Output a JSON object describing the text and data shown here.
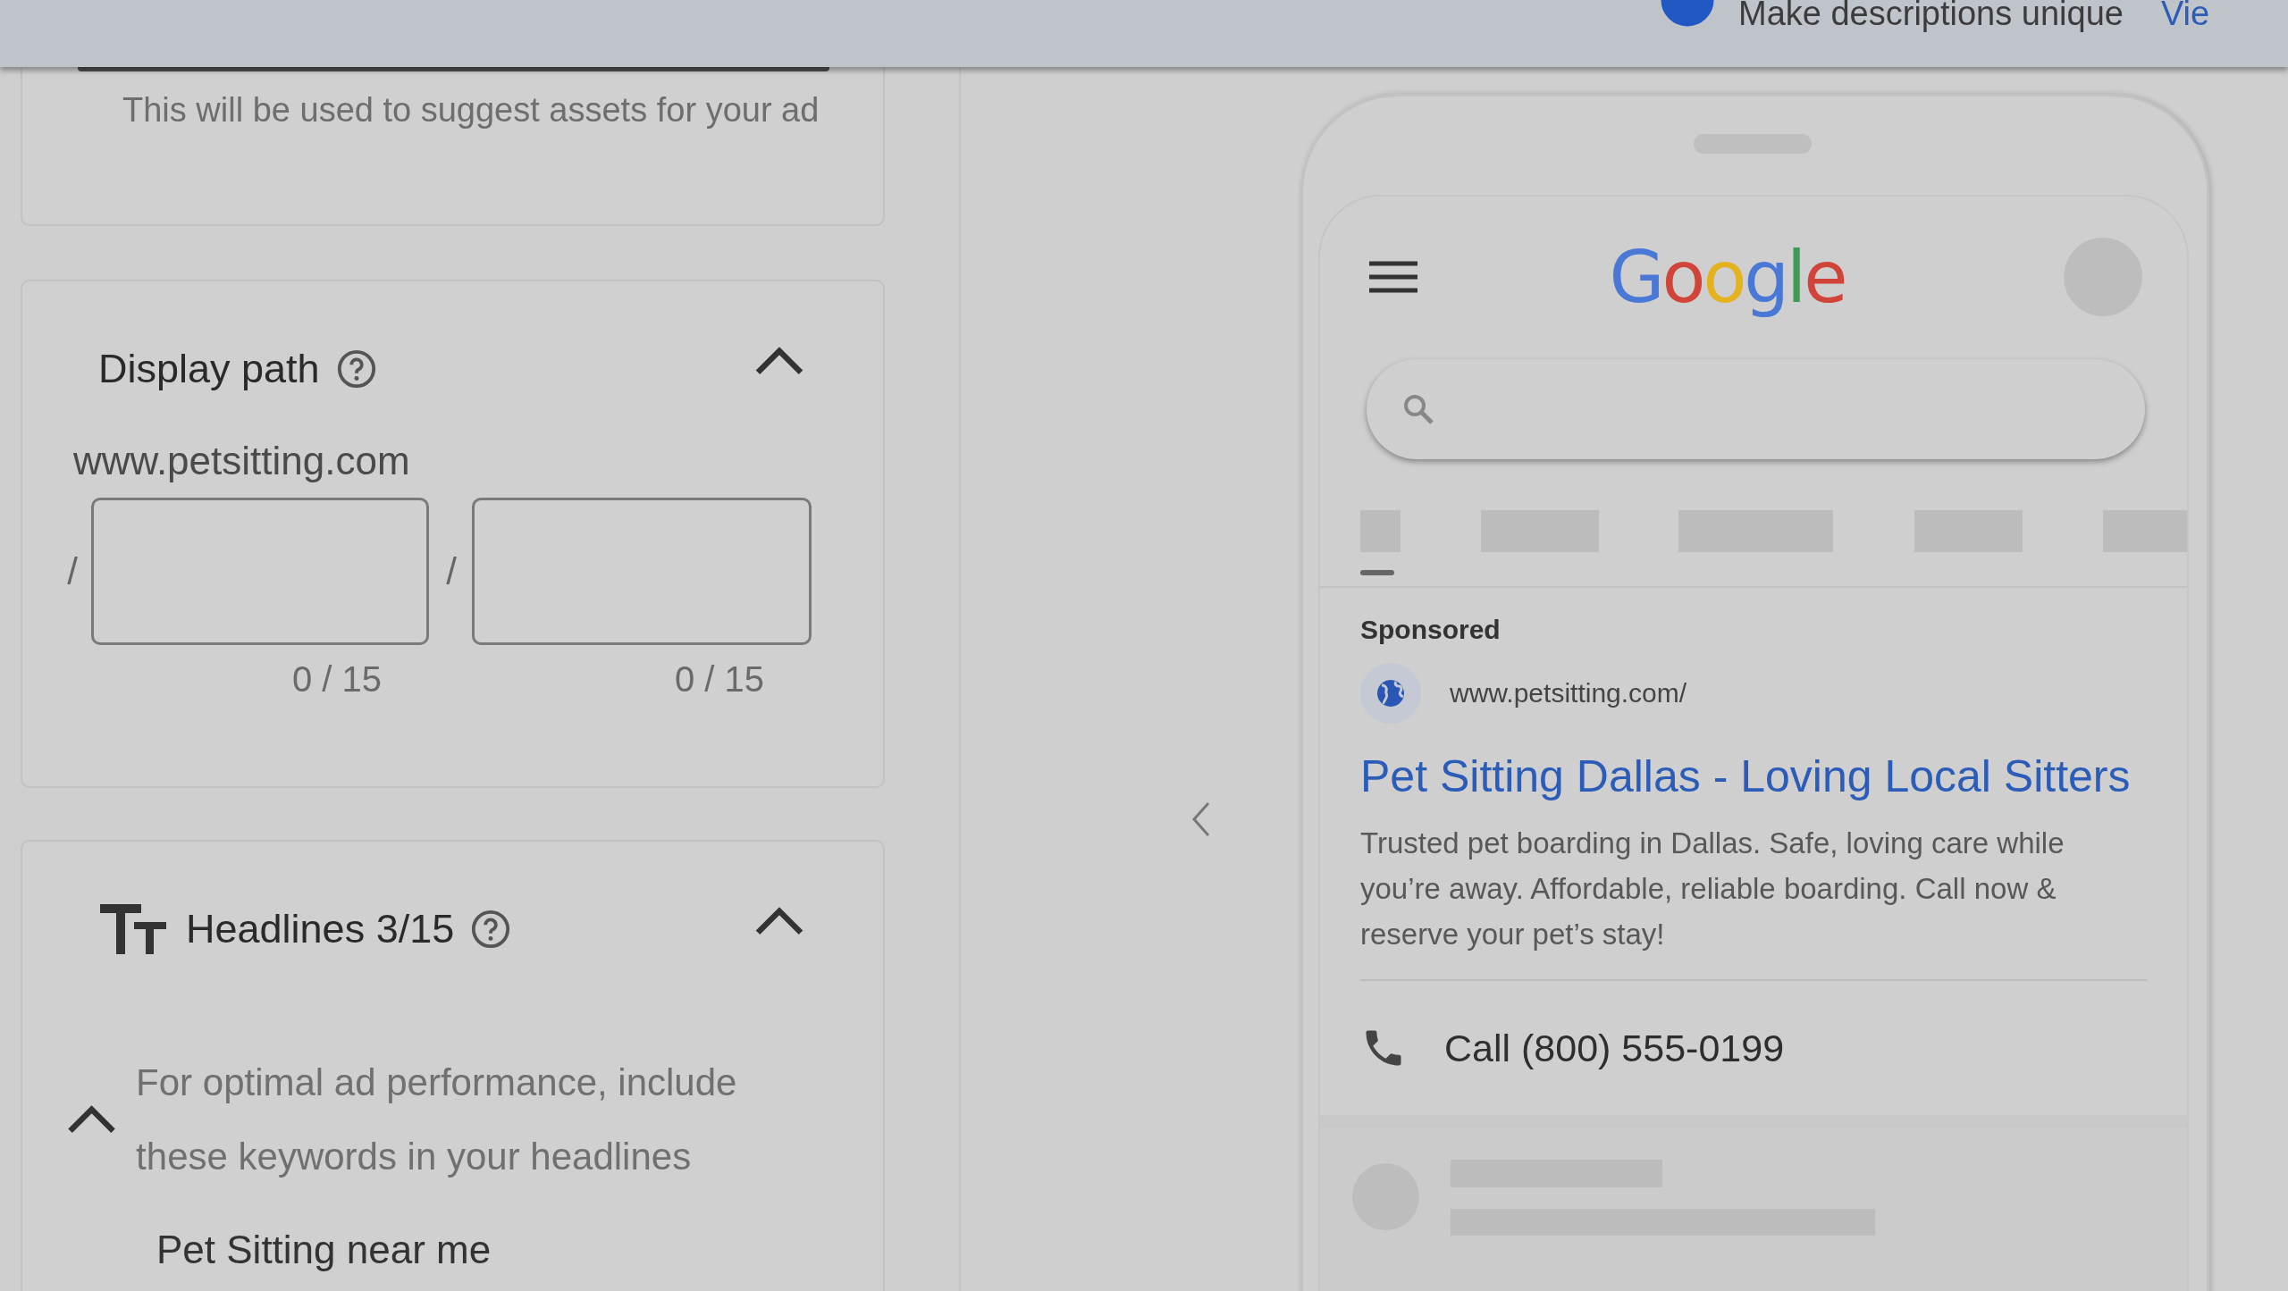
{
  "top_bar": {
    "message": "Make descriptions unique",
    "link": "Vie"
  },
  "business_hint": "This will be used to suggest assets for your ad",
  "display_path": {
    "title": "Display path",
    "expanded": true,
    "domain": "www.petsitting.com",
    "fields": [
      {
        "separator": "/",
        "counter": "0 / 15"
      },
      {
        "separator": "/",
        "counter": "0 / 15"
      }
    ]
  },
  "headlines": {
    "title": "Headlines 3/15",
    "expanded": true,
    "keyword_hint": {
      "text": "For optimal ad performance, include these keywords in your headlines",
      "expanded": true
    },
    "keywords": [
      "Pet Sitting near me"
    ]
  },
  "preview": {
    "logo": "Google",
    "sponsored_label": "Sponsored",
    "display_url": "www.petsitting.com/",
    "headline": "Pet Sitting Dallas - Loving Local Sitters",
    "description": "Trusted pet boarding in Dallas. Safe, loving care while you’re away. Affordable, reliable boarding. Call now & reserve your pet’s stay!",
    "call": "Call (800) 555-0199"
  }
}
